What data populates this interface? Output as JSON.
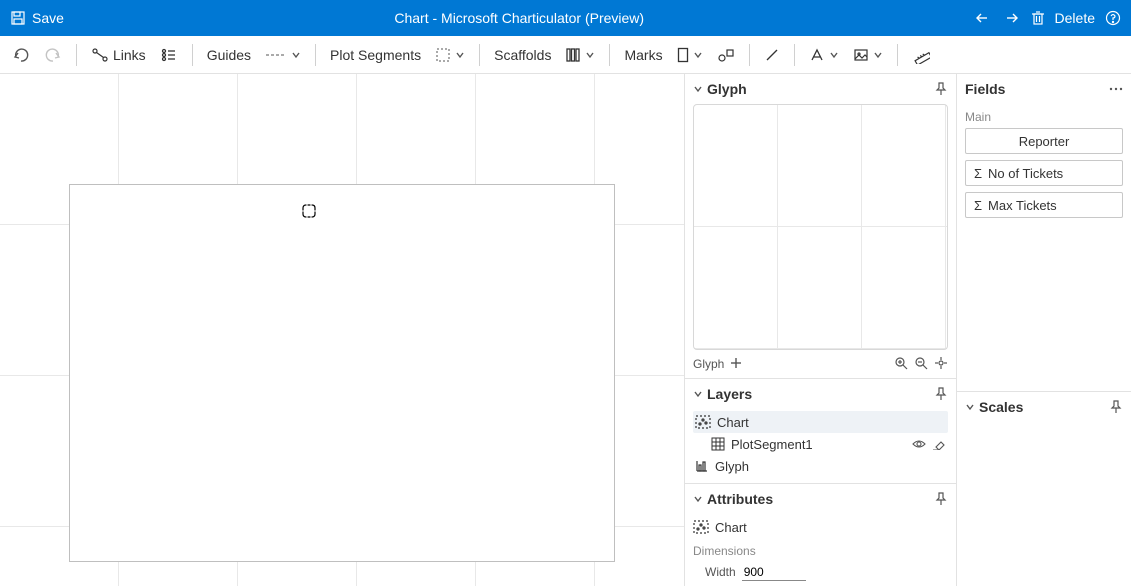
{
  "titlebar": {
    "save": "Save",
    "title": "Chart - Microsoft Charticulator (Preview)",
    "delete": "Delete"
  },
  "toolbar": {
    "links": "Links",
    "guides": "Guides",
    "plot_segments": "Plot Segments",
    "scaffolds": "Scaffolds",
    "marks": "Marks"
  },
  "glyph_panel": {
    "title": "Glyph",
    "footer_label": "Glyph"
  },
  "layers_panel": {
    "title": "Layers",
    "items": {
      "chart": "Chart",
      "plot1": "PlotSegment1",
      "glyph": "Glyph"
    }
  },
  "attributes_panel": {
    "title": "Attributes",
    "subject": "Chart",
    "dimensions_label": "Dimensions",
    "width_label": "Width",
    "width_value": "900"
  },
  "fields_panel": {
    "title": "Fields",
    "main_label": "Main",
    "items": {
      "reporter": "Reporter",
      "no_tickets": "No of Tickets",
      "max_tickets": "Max Tickets"
    }
  },
  "scales_panel": {
    "title": "Scales"
  }
}
